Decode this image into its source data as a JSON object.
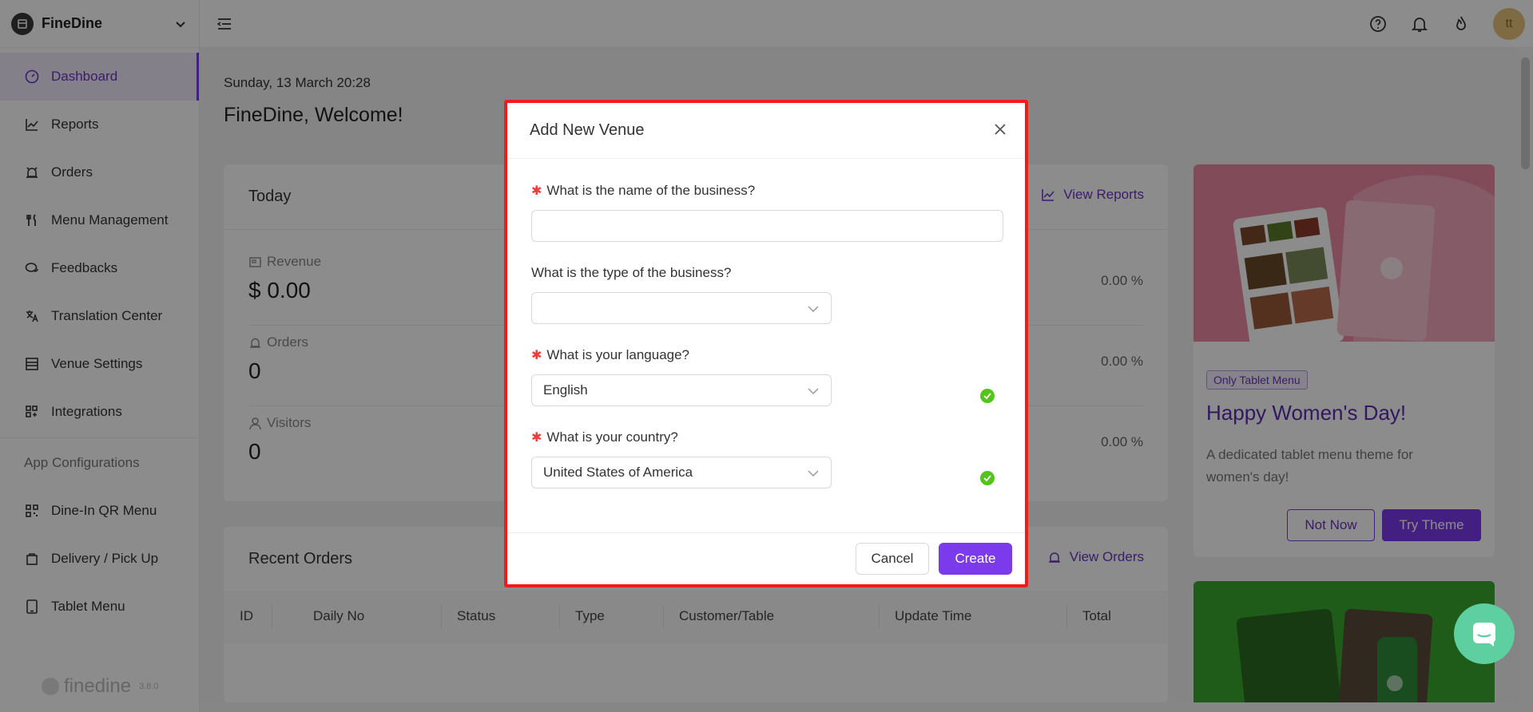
{
  "brand": {
    "name": "FineDine"
  },
  "sidebar": {
    "items": [
      {
        "label": "Dashboard"
      },
      {
        "label": "Reports"
      },
      {
        "label": "Orders"
      },
      {
        "label": "Menu Management"
      },
      {
        "label": "Feedbacks"
      },
      {
        "label": "Translation Center"
      },
      {
        "label": "Venue Settings"
      },
      {
        "label": "Integrations"
      }
    ],
    "section_label": "App Configurations",
    "app_items": [
      {
        "label": "Dine-In QR Menu"
      },
      {
        "label": "Delivery / Pick Up"
      },
      {
        "label": "Tablet Menu"
      }
    ],
    "footer": {
      "name": "finedine",
      "version": "3.8.0"
    }
  },
  "topbar": {
    "avatar_initials": "tt"
  },
  "main": {
    "date": "Sunday, 13 March 20:28",
    "welcome": "FineDine, Welcome!",
    "today": {
      "title": "Today",
      "link": "View Reports",
      "stats": [
        {
          "label": "Revenue",
          "value": "$ 0.00",
          "pct": "0.00 %"
        },
        {
          "label": "Orders",
          "value": "0",
          "pct": "0.00 %"
        },
        {
          "label": "Visitors",
          "value": "0",
          "pct": "0.00 %"
        }
      ]
    },
    "recent": {
      "title": "Recent Orders",
      "link": "View Orders",
      "columns": [
        "ID",
        "Daily No",
        "Status",
        "Type",
        "Customer/Table",
        "Update Time",
        "Total"
      ]
    },
    "promo": {
      "badge": "Only Tablet Menu",
      "title": "Happy Women's Day!",
      "desc": "A dedicated tablet menu theme for women's day!",
      "not_now": "Not Now",
      "try": "Try Theme"
    }
  },
  "modal": {
    "title": "Add New Venue",
    "q_name": "What is the name of the business?",
    "name_value": "",
    "q_type": "What is the type of the business?",
    "type_value": "",
    "q_language": "What is your language?",
    "language_value": "English",
    "q_country": "What is your country?",
    "country_value": "United States of America",
    "cancel": "Cancel",
    "create": "Create"
  },
  "colors": {
    "accent": "#7c3aed",
    "highlight": "#ee1c1c",
    "success": "#52c41a"
  }
}
